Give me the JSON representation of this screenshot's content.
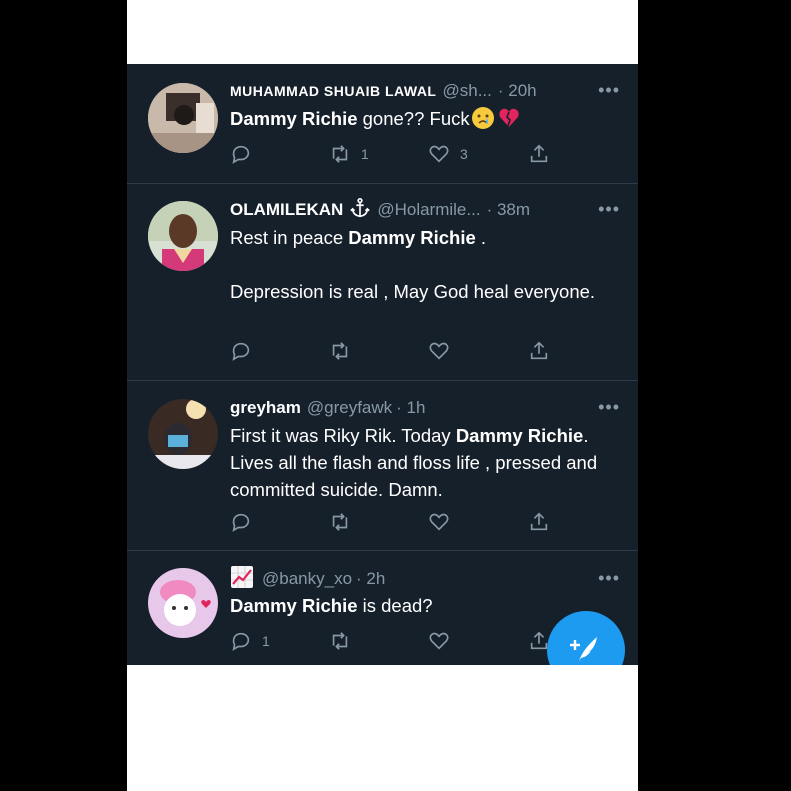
{
  "tweets": [
    {
      "name": "MUHAMMAD SHUAIB LAWAL",
      "handle": "@sh...",
      "time": "· 20h",
      "text_bold": "Dammy Richie",
      "text_rest": " gone?? Fuck",
      "emoji_icons": [
        "crying-face-emoji",
        "broken-heart-emoji"
      ],
      "reply_count": "",
      "retweet_count": "1",
      "like_count": "3"
    },
    {
      "name": "OLAMILEKAN",
      "name_icon": "anchor-icon",
      "handle": "@Holarmile...",
      "time": "· 38m",
      "text_pre": "Rest in peace ",
      "text_bold": "Dammy Richie",
      "text_post": " .\n\nDepression is real , May God heal everyone.",
      "reply_count": "",
      "retweet_count": "",
      "like_count": ""
    },
    {
      "name": "greyham",
      "handle": "@greyfawk",
      "time": "· 1h",
      "text_pre": "First it was Riky Rik. Today ",
      "text_bold": "Dammy Richie",
      "text_post": ". Lives all the flash and floss life , pressed and committed suicide. Damn.",
      "reply_count": "",
      "retweet_count": "",
      "like_count": ""
    },
    {
      "name_icon": "chart-increasing-emoji",
      "handle": "@banky_xo",
      "time": "· 2h",
      "text_bold": "Dammy Richie",
      "text_post": " is dead?",
      "reply_count": "1",
      "retweet_count": "",
      "like_count": ""
    }
  ],
  "more_label": "•••",
  "compose_icon": "compose-tweet-icon",
  "colors": {
    "background": "#16202b",
    "accent": "#1d9bf0",
    "muted": "#8899a6",
    "divider": "#2f3b47"
  }
}
